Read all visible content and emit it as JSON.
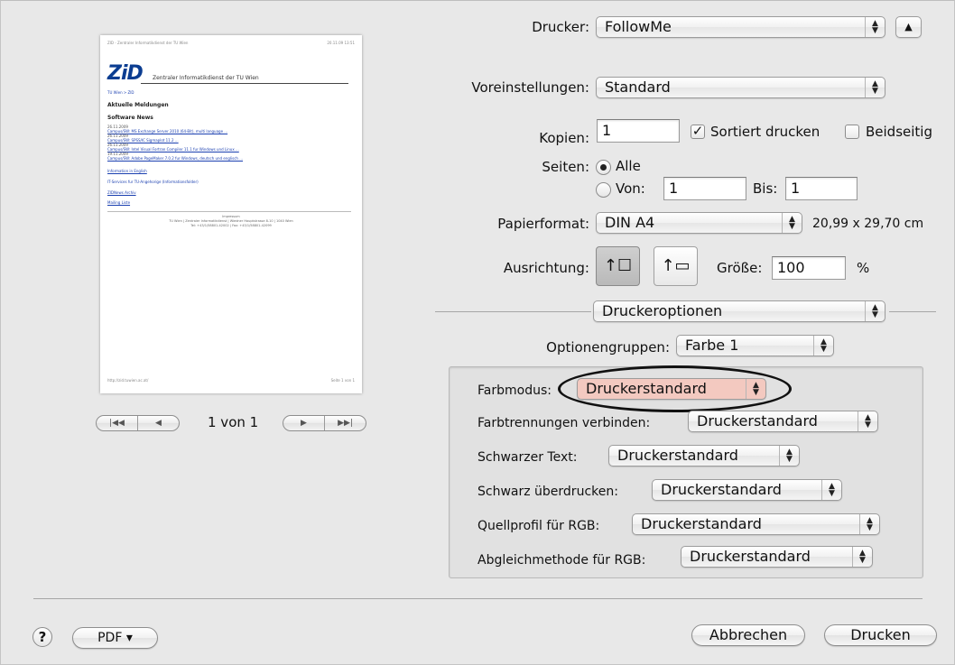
{
  "preview": {
    "header_left": "ZID - Zentraler Informatikdienst der TU Wien",
    "header_right": "20.11.09 13:51",
    "logo": "ZiD",
    "logo_subtitle": "Zentraler Informatikdienst der TU Wien",
    "breadcrumb": "TU Wien > ZID",
    "heading": "Aktuelle Meldungen",
    "subheading": "Software News",
    "news": [
      "26.11.2009",
      "Campus/SW: MS Exchange Server 2010 (64-Bit), multi language ...",
      "26.11.2009",
      "Campus/SW: SPSS/IC Sigmaplot 11.2 ...",
      "26.11.2009",
      "Campus/SW: Intel Visual Fortran Compiler 11.1 fur Windows und Linux ...",
      "19.11.2009",
      "Campus/SW: Adobe PageMaker 7.0.2 fur Windows, deutsch und englisch ..."
    ],
    "links": [
      "Information in English",
      "IT-Services fur TU-Angehorige (Informationsfolder)",
      "ZIDNews Archiv",
      "Mailing Liste"
    ],
    "footer_1": "Impressum",
    "footer_2": "TU Wien | Zentraler Informatikdienst | Wiedner Hauptstrasse 8-10 | 1040 Wien",
    "footer_3": "Tel: +43/1/58801-42002 | Fax: +43/1/58801-42099",
    "bottom_left": "http://zid.tuwien.ac.at/",
    "bottom_right": "Seite 1 von 1"
  },
  "pager": {
    "first": "|◀◀",
    "prev": "◀",
    "status": "1 von 1",
    "next": "▶",
    "last": "▶▶|"
  },
  "printer": {
    "label": "Drucker:",
    "value": "FollowMe"
  },
  "presets": {
    "label": "Voreinstellungen:",
    "value": "Standard"
  },
  "copies": {
    "label": "Kopien:",
    "value": "1",
    "collate_label": "Sortiert drucken",
    "collate_checked": true,
    "duplex_label": "Beidseitig",
    "duplex_checked": false
  },
  "pages": {
    "label": "Seiten:",
    "all_label": "Alle",
    "from_label": "Von:",
    "from_value": "1",
    "to_label": "Bis:",
    "to_value": "1",
    "selected": "Alle"
  },
  "paper": {
    "label": "Papierformat:",
    "value": "DIN A4",
    "size": "20,99 x 29,70 cm"
  },
  "orientation": {
    "label": "Ausrichtung:",
    "selected": "portrait",
    "scale_label": "Größe:",
    "scale_value": "100",
    "scale_unit": "%"
  },
  "section": {
    "value": "Druckeroptionen"
  },
  "option_groups": {
    "label": "Optionengruppen:",
    "value": "Farbe 1"
  },
  "options": [
    {
      "label": "Farbmodus:",
      "value": "Druckerstandard"
    },
    {
      "label": "Farbtrennungen verbinden:",
      "value": "Druckerstandard"
    },
    {
      "label": "Schwarzer Text:",
      "value": "Druckerstandard"
    },
    {
      "label": "Schwarz überdrucken:",
      "value": "Druckerstandard"
    },
    {
      "label": "Quellprofil für RGB:",
      "value": "Druckerstandard"
    },
    {
      "label": "Abgleichmethode für RGB:",
      "value": "Druckerstandard"
    }
  ],
  "footer": {
    "help": "?",
    "pdf": "PDF ▾",
    "cancel": "Abbrechen",
    "print": "Drucken"
  },
  "colors": {
    "highlight_fill": "#f3c9c0",
    "highlight_ring": "#111111",
    "link": "#1a3fb0"
  }
}
